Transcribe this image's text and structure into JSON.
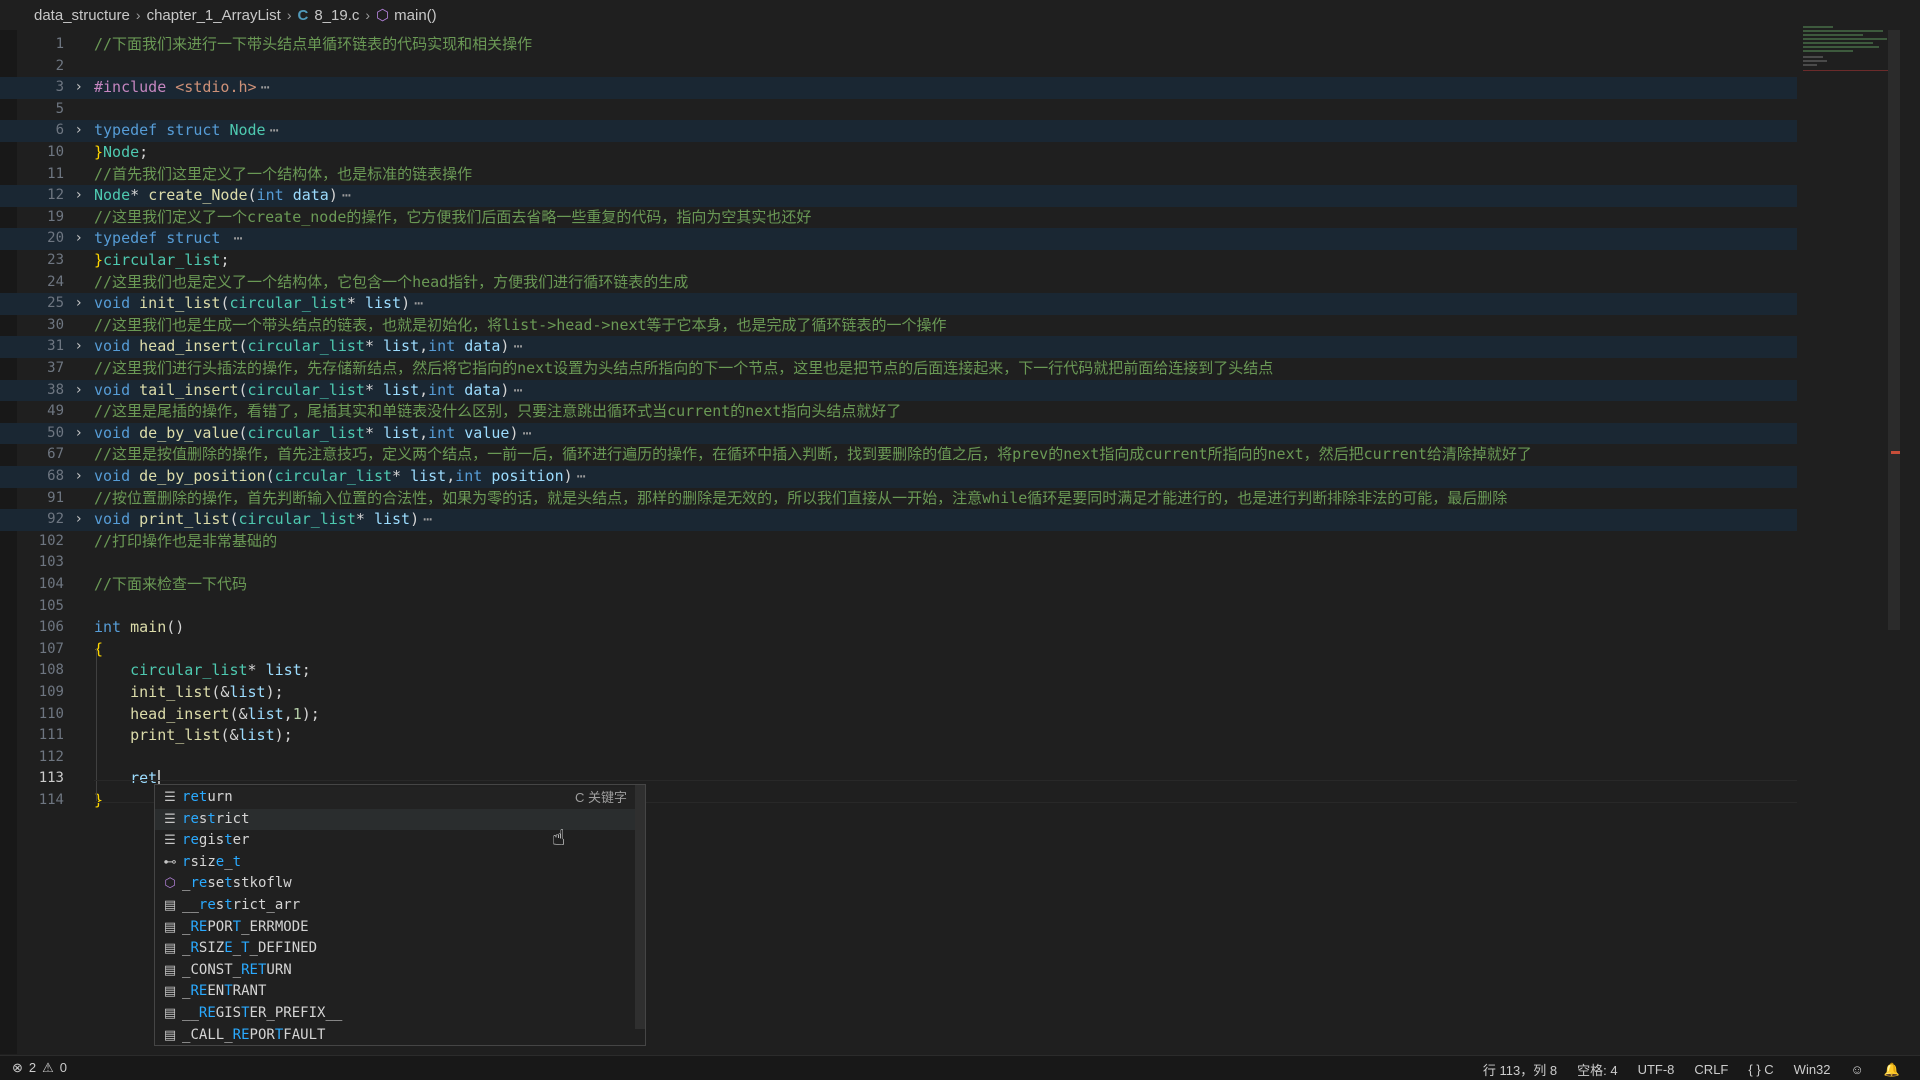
{
  "breadcrumb": {
    "folder1": "data_structure",
    "folder2": "chapter_1_ArrayList",
    "file_icon": "C",
    "file": "8_19.c",
    "symbol": "main()"
  },
  "lines": [
    {
      "n": "1",
      "code": [
        {
          "c": "cm",
          "t": "//下面我们来进行一下带头结点单循环链表的代码实现和相关操作"
        }
      ]
    },
    {
      "n": "2",
      "code": []
    },
    {
      "n": "3",
      "fold": true,
      "code": [
        {
          "c": "pp",
          "t": "#include"
        },
        {
          "c": "str",
          "t": " <stdio.h>"
        }
      ]
    },
    {
      "n": "5",
      "code": []
    },
    {
      "n": "6",
      "fold": true,
      "code": [
        {
          "c": "kw",
          "t": "typedef"
        },
        {
          "c": "tx",
          "t": " "
        },
        {
          "c": "kw",
          "t": "struct"
        },
        {
          "c": "tx",
          "t": " "
        },
        {
          "c": "ty",
          "t": "Node"
        }
      ]
    },
    {
      "n": "10",
      "code": [
        {
          "c": "brace",
          "t": "}"
        },
        {
          "c": "ty",
          "t": "Node"
        },
        {
          "c": "tx",
          "t": ";"
        }
      ]
    },
    {
      "n": "11",
      "code": [
        {
          "c": "cm",
          "t": "//首先我们这里定义了一个结构体，也是标准的链表操作"
        }
      ]
    },
    {
      "n": "12",
      "fold": true,
      "code": [
        {
          "c": "ty",
          "t": "Node"
        },
        {
          "c": "tx",
          "t": "* "
        },
        {
          "c": "fn",
          "t": "create_Node"
        },
        {
          "c": "tx",
          "t": "("
        },
        {
          "c": "kw",
          "t": "int"
        },
        {
          "c": "tx",
          "t": " "
        },
        {
          "c": "id",
          "t": "data"
        },
        {
          "c": "tx",
          "t": ")"
        }
      ]
    },
    {
      "n": "19",
      "code": [
        {
          "c": "cm",
          "t": "//这里我们定义了一个create_node的操作，它方便我们后面去省略一些重复的代码，指向为空其实也还好"
        }
      ]
    },
    {
      "n": "20",
      "fold": true,
      "code": [
        {
          "c": "kw",
          "t": "typedef"
        },
        {
          "c": "tx",
          "t": " "
        },
        {
          "c": "kw",
          "t": "struct"
        },
        {
          "c": "tx",
          "t": " "
        }
      ]
    },
    {
      "n": "23",
      "code": [
        {
          "c": "brace",
          "t": "}"
        },
        {
          "c": "ty",
          "t": "circular_list"
        },
        {
          "c": "tx",
          "t": ";"
        }
      ]
    },
    {
      "n": "24",
      "code": [
        {
          "c": "cm",
          "t": "//这里我们也是定义了一个结构体，它包含一个head指针，方便我们进行循环链表的生成"
        }
      ]
    },
    {
      "n": "25",
      "fold": true,
      "code": [
        {
          "c": "kw",
          "t": "void"
        },
        {
          "c": "tx",
          "t": " "
        },
        {
          "c": "fn",
          "t": "init_list"
        },
        {
          "c": "tx",
          "t": "("
        },
        {
          "c": "ty",
          "t": "circular_list"
        },
        {
          "c": "tx",
          "t": "* "
        },
        {
          "c": "id",
          "t": "list"
        },
        {
          "c": "tx",
          "t": ")"
        }
      ]
    },
    {
      "n": "30",
      "code": [
        {
          "c": "cm",
          "t": "//这里我们也是生成一个带头结点的链表，也就是初始化，将list->head->next等于它本身，也是完成了循环链表的一个操作"
        }
      ]
    },
    {
      "n": "31",
      "fold": true,
      "code": [
        {
          "c": "kw",
          "t": "void"
        },
        {
          "c": "tx",
          "t": " "
        },
        {
          "c": "fn",
          "t": "head_insert"
        },
        {
          "c": "tx",
          "t": "("
        },
        {
          "c": "ty",
          "t": "circular_list"
        },
        {
          "c": "tx",
          "t": "* "
        },
        {
          "c": "id",
          "t": "list"
        },
        {
          "c": "tx",
          "t": ","
        },
        {
          "c": "kw",
          "t": "int"
        },
        {
          "c": "tx",
          "t": " "
        },
        {
          "c": "id",
          "t": "data"
        },
        {
          "c": "tx",
          "t": ")"
        }
      ]
    },
    {
      "n": "37",
      "code": [
        {
          "c": "cm",
          "t": "//这里我们进行头插法的操作，先存储新结点，然后将它指向的next设置为头结点所指向的下一个节点，这里也是把节点的后面连接起来，下一行代码就把前面给连接到了头结点"
        }
      ]
    },
    {
      "n": "38",
      "fold": true,
      "code": [
        {
          "c": "kw",
          "t": "void"
        },
        {
          "c": "tx",
          "t": " "
        },
        {
          "c": "fn",
          "t": "tail_insert"
        },
        {
          "c": "tx",
          "t": "("
        },
        {
          "c": "ty",
          "t": "circular_list"
        },
        {
          "c": "tx",
          "t": "* "
        },
        {
          "c": "id",
          "t": "list"
        },
        {
          "c": "tx",
          "t": ","
        },
        {
          "c": "kw",
          "t": "int"
        },
        {
          "c": "tx",
          "t": " "
        },
        {
          "c": "id",
          "t": "data"
        },
        {
          "c": "tx",
          "t": ")"
        }
      ]
    },
    {
      "n": "49",
      "code": [
        {
          "c": "cm",
          "t": "//这里是尾插的操作，看错了，尾插其实和单链表没什么区别，只要注意跳出循环式当current的next指向头结点就好了"
        }
      ]
    },
    {
      "n": "50",
      "fold": true,
      "code": [
        {
          "c": "kw",
          "t": "void"
        },
        {
          "c": "tx",
          "t": " "
        },
        {
          "c": "fn",
          "t": "de_by_value"
        },
        {
          "c": "tx",
          "t": "("
        },
        {
          "c": "ty",
          "t": "circular_list"
        },
        {
          "c": "tx",
          "t": "* "
        },
        {
          "c": "id",
          "t": "list"
        },
        {
          "c": "tx",
          "t": ","
        },
        {
          "c": "kw",
          "t": "int"
        },
        {
          "c": "tx",
          "t": " "
        },
        {
          "c": "id",
          "t": "value"
        },
        {
          "c": "tx",
          "t": ")"
        }
      ]
    },
    {
      "n": "67",
      "code": [
        {
          "c": "cm",
          "t": "//这里是按值删除的操作，首先注意技巧，定义两个结点，一前一后，循环进行遍历的操作，在循环中插入判断，找到要删除的值之后，将prev的next指向成current所指向的next，然后把current给清除掉就好了"
        }
      ]
    },
    {
      "n": "68",
      "fold": true,
      "code": [
        {
          "c": "kw",
          "t": "void"
        },
        {
          "c": "tx",
          "t": " "
        },
        {
          "c": "fn",
          "t": "de_by_position"
        },
        {
          "c": "tx",
          "t": "("
        },
        {
          "c": "ty",
          "t": "circular_list"
        },
        {
          "c": "tx",
          "t": "* "
        },
        {
          "c": "id",
          "t": "list"
        },
        {
          "c": "tx",
          "t": ","
        },
        {
          "c": "kw",
          "t": "int"
        },
        {
          "c": "tx",
          "t": " "
        },
        {
          "c": "id",
          "t": "position"
        },
        {
          "c": "tx",
          "t": ")"
        }
      ]
    },
    {
      "n": "91",
      "code": [
        {
          "c": "cm",
          "t": "//按位置删除的操作，首先判断输入位置的合法性，如果为零的话，就是头结点，那样的删除是无效的，所以我们直接从一开始，注意while循环是要同时满足才能进行的，也是进行判断排除非法的可能，最后删除"
        }
      ]
    },
    {
      "n": "92",
      "fold": true,
      "code": [
        {
          "c": "kw",
          "t": "void"
        },
        {
          "c": "tx",
          "t": " "
        },
        {
          "c": "fn",
          "t": "print_list"
        },
        {
          "c": "tx",
          "t": "("
        },
        {
          "c": "ty",
          "t": "circular_list"
        },
        {
          "c": "tx",
          "t": "* "
        },
        {
          "c": "id",
          "t": "list"
        },
        {
          "c": "tx",
          "t": ")"
        }
      ]
    },
    {
      "n": "102",
      "code": [
        {
          "c": "cm",
          "t": "//打印操作也是非常基础的"
        }
      ]
    },
    {
      "n": "103",
      "code": []
    },
    {
      "n": "104",
      "code": [
        {
          "c": "cm",
          "t": "//下面来检查一下代码"
        }
      ]
    },
    {
      "n": "105",
      "code": []
    },
    {
      "n": "106",
      "code": [
        {
          "c": "kw",
          "t": "int"
        },
        {
          "c": "tx",
          "t": " "
        },
        {
          "c": "fn",
          "t": "main"
        },
        {
          "c": "tx",
          "t": "()"
        }
      ]
    },
    {
      "n": "107",
      "code": [
        {
          "c": "brace",
          "t": "{"
        }
      ]
    },
    {
      "n": "108",
      "code": [
        {
          "c": "tx",
          "t": "    "
        },
        {
          "c": "ty",
          "t": "circular_list"
        },
        {
          "c": "tx",
          "t": "* "
        },
        {
          "c": "id",
          "t": "list"
        },
        {
          "c": "tx",
          "t": ";"
        }
      ]
    },
    {
      "n": "109",
      "code": [
        {
          "c": "tx",
          "t": "    "
        },
        {
          "c": "fn",
          "t": "init_list"
        },
        {
          "c": "tx",
          "t": "(&"
        },
        {
          "c": "id",
          "t": "list"
        },
        {
          "c": "tx",
          "t": ");"
        }
      ]
    },
    {
      "n": "110",
      "code": [
        {
          "c": "tx",
          "t": "    "
        },
        {
          "c": "fn",
          "t": "head_insert"
        },
        {
          "c": "tx",
          "t": "(&"
        },
        {
          "c": "id",
          "t": "list"
        },
        {
          "c": "tx",
          "t": ","
        },
        {
          "c": "num",
          "t": "1"
        },
        {
          "c": "tx",
          "t": ");"
        }
      ]
    },
    {
      "n": "111",
      "code": [
        {
          "c": "tx",
          "t": "    "
        },
        {
          "c": "fn",
          "t": "print_list"
        },
        {
          "c": "tx",
          "t": "(&"
        },
        {
          "c": "id",
          "t": "list"
        },
        {
          "c": "tx",
          "t": ");"
        }
      ]
    },
    {
      "n": "112",
      "code": []
    },
    {
      "n": "113",
      "active": true,
      "code": [
        {
          "c": "tx",
          "t": "    "
        },
        {
          "c": "id",
          "t": "ret"
        }
      ]
    },
    {
      "n": "114",
      "code": [
        {
          "c": "brace",
          "t": "}"
        }
      ]
    }
  ],
  "suggestions": [
    {
      "icon": "keyword-icon",
      "glyph": "☰",
      "label": "return",
      "detail": "C 关键字"
    },
    {
      "icon": "keyword-icon",
      "glyph": "☰",
      "label": "restrict",
      "detail": ""
    },
    {
      "icon": "keyword-icon",
      "glyph": "☰",
      "label": "register",
      "detail": ""
    },
    {
      "icon": "typedef-icon",
      "glyph": "⊷",
      "label": "rsize_t",
      "detail": ""
    },
    {
      "icon": "function-icon",
      "glyph": "⬡",
      "label": "_resetstkoflw",
      "detail": ""
    },
    {
      "icon": "text-icon",
      "glyph": "▤",
      "label": "__restrict_arr",
      "detail": ""
    },
    {
      "icon": "text-icon",
      "glyph": "▤",
      "label": "_REPORT_ERRMODE",
      "detail": ""
    },
    {
      "icon": "text-icon",
      "glyph": "▤",
      "label": "_RSIZE_T_DEFINED",
      "detail": ""
    },
    {
      "icon": "text-icon",
      "glyph": "▤",
      "label": "_CONST_RETURN",
      "detail": ""
    },
    {
      "icon": "text-icon",
      "glyph": "▤",
      "label": "_REENTRANT",
      "detail": ""
    },
    {
      "icon": "text-icon",
      "glyph": "▤",
      "label": "__REGISTER_PREFIX__",
      "detail": ""
    },
    {
      "icon": "text-icon",
      "glyph": "▤",
      "label": "_CALL_REPORTFAULT",
      "detail": ""
    }
  ],
  "status": {
    "errors": "2",
    "warnings": "0",
    "position": "行 113，列 8",
    "spaces": "空格: 4",
    "encoding": "UTF-8",
    "eol": "CRLF",
    "language": "{ } C",
    "platform": "Win32"
  },
  "colors": {
    "background": "#1f1f1f",
    "fold_highlight": "#1a2733",
    "comment": "#6a9955",
    "keyword": "#569cd6",
    "match": "#2aaaff"
  }
}
